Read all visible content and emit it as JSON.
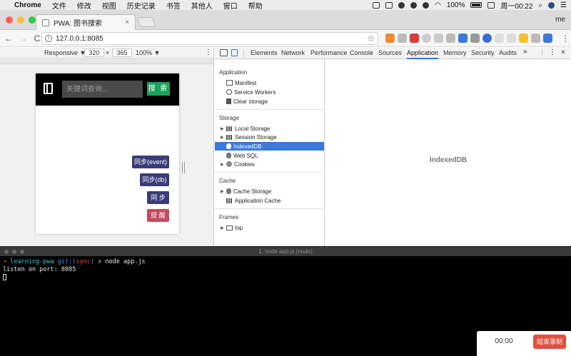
{
  "menubar": {
    "app": "Chrome",
    "items": [
      "文件",
      "修改",
      "视图",
      "历史记录",
      "书签",
      "其他人",
      "窗口",
      "帮助"
    ],
    "battery": "100%",
    "clock": "周一00:22"
  },
  "browser": {
    "tab_title": "PWA: 图书搜索",
    "tab_close": "×",
    "profile": "me",
    "url": "127.0.0.1:8085",
    "back": "←",
    "forward": "→",
    "reload": "C",
    "star": "☆",
    "info": "i"
  },
  "device_toolbar": {
    "mode": "Responsive ▼",
    "width": "320",
    "times": "×",
    "height": "365",
    "zoom": "100% ▼",
    "more": "⋮"
  },
  "app": {
    "search_placeholder": "关键词查询...",
    "search_button": "搜 索",
    "buttons": [
      "同步(event)",
      "同步(db)",
      "同 步",
      "提 醒"
    ]
  },
  "devtools": {
    "tabs": [
      "Elements",
      "Network",
      "Performance",
      "Console",
      "Sources",
      "Application",
      "Memory",
      "Security",
      "Audits"
    ],
    "active_tab": "Application",
    "overflow": "»",
    "menu": "⋮",
    "close": "×",
    "sections": {
      "application": {
        "title": "Application",
        "items": [
          "Manifest",
          "Service Workers",
          "Clear storage"
        ]
      },
      "storage": {
        "title": "Storage",
        "items": [
          "Local Storage",
          "Session Storage",
          "IndexedDB",
          "Web SQL",
          "Cookies"
        ]
      },
      "cache": {
        "title": "Cache",
        "items": [
          "Cache Storage",
          "Application Cache"
        ]
      },
      "frames": {
        "title": "Frames",
        "items": [
          "top"
        ]
      }
    },
    "selected_item": "IndexedDB",
    "main_placeholder": "IndexedDB"
  },
  "terminal": {
    "title": "1. node app.js (node)",
    "prompt_arrow": "➜",
    "dir": "learning-pwa",
    "git_label": "git:(",
    "branch": "sync",
    "git_close": ")",
    "dirty_mark": "✗",
    "command": "node app.js",
    "output": "listen on port: 8085"
  },
  "recorder": {
    "time": "00:00",
    "stop_label": "结束录制"
  },
  "colors": {
    "search_green": "#1aa35a",
    "button_indigo": "#3b3b7a",
    "button_red": "#c44a5d",
    "selection_blue": "#3879d9",
    "stop_red": "#e34e3d"
  }
}
